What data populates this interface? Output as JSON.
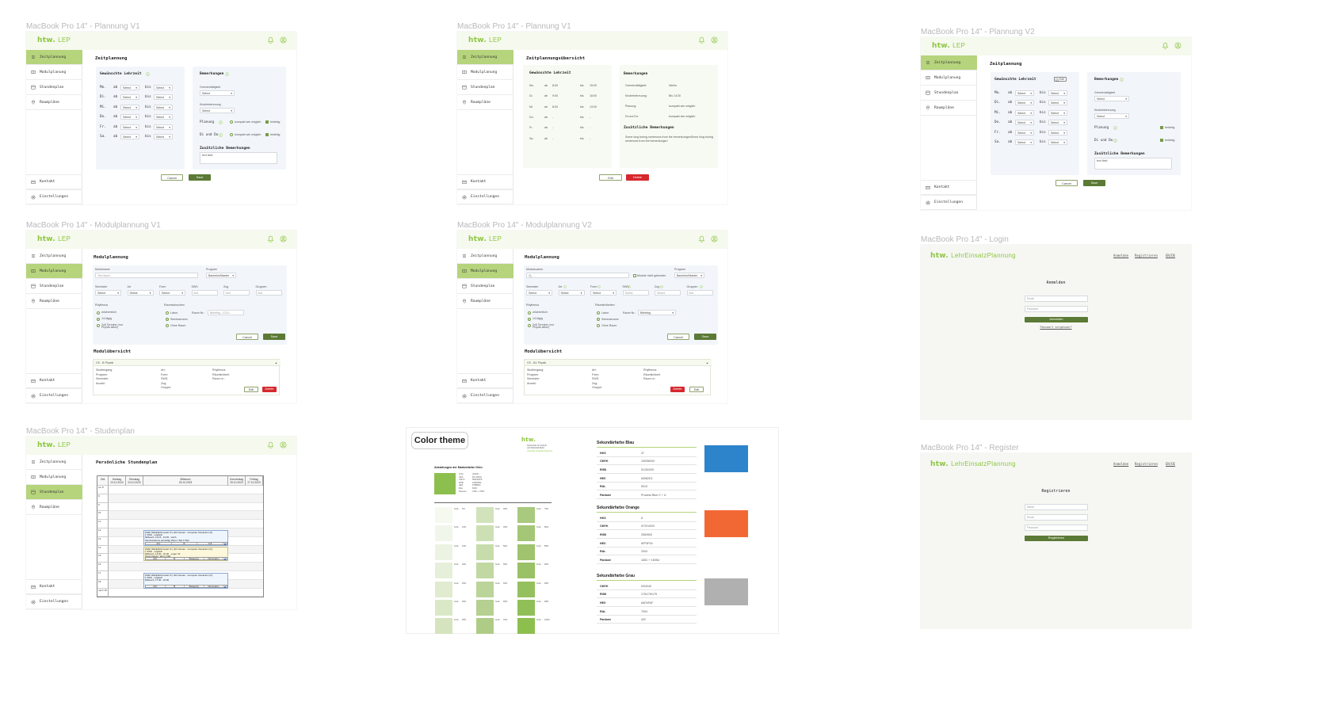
{
  "frames": {
    "plan_v1": {
      "label": "MacBook Pro 14\" - Plannung V1"
    },
    "plan_overview": {
      "label": "MacBook Pro 14\" - Plannung V1"
    },
    "plan_v2": {
      "label": "MacBook Pro 14\" - Plannung V2"
    },
    "modul_v1": {
      "label": "MacBook Pro 14\" - Modulplannung V1"
    },
    "modul_v2": {
      "label": "MacBook Pro 14\" - Modulplannung V2"
    },
    "login": {
      "label": "MacBook Pro 14\" - Login"
    },
    "stundenplan": {
      "label": "MacBook Pro 14\" - Studenplan"
    },
    "register": {
      "label": "MacBook Pro 14\" - Register"
    }
  },
  "brand": {
    "logo": "htw.",
    "app_short": "LEP",
    "app_long": "LehrEinsatzPlannung"
  },
  "nav": {
    "items": [
      "Zeitplannung",
      "Modulplanung",
      "Stundenplan",
      "Raumpläne"
    ],
    "icons": [
      "list-icon",
      "book-icon",
      "calendar-icon",
      "map-pin-icon"
    ],
    "bottom": [
      "Kontakt",
      "Einstellungen"
    ],
    "bottom_icons": [
      "mail-icon",
      "gear-icon"
    ]
  },
  "header_icons": [
    "bell-icon",
    "user-circle-icon"
  ],
  "colors": {
    "brand_green": "#8cc63f",
    "active_nav": "#b5d47c",
    "primary_button": "#5b7a35",
    "delete_button": "#d6282d",
    "panel_blue": "#f2f6fb",
    "header_green": "#f5f9ee"
  },
  "zeitplanung": {
    "title": "Zeitplannung",
    "lehrzeit": "Gewünschte Lehrzeit",
    "days": [
      "Mo.",
      "Di.",
      "Mi.",
      "Do.",
      "Fr.",
      "Sa."
    ],
    "ab": "ab",
    "bis": "bis",
    "select": "Select",
    "bemerkungen": "Bemerkungen",
    "gremien": "Gremientätigkeit",
    "kinder": "Kinderbetreuung",
    "planung": "Planung",
    "didu": "Di und Do",
    "kompakt": "kompakt wie möglich",
    "beliebig": "beliebig",
    "zusatz": "Zusätzliche Bemerkungen",
    "textfield": "text field",
    "cancel": "Cancel",
    "save": "Save",
    "edit": "Edit"
  },
  "overview": {
    "title": "Zeitplannungsübersicht",
    "rows": [
      {
        "day": "Mo.",
        "from": "8:00",
        "to": "15:00"
      },
      {
        "day": "Di.",
        "from": "9:00",
        "to": "18:00"
      },
      {
        "day": "Mi.",
        "from": "8:00",
        "to": "13:00"
      },
      {
        "day": "Do.",
        "from": "-",
        "to": "-"
      },
      {
        "day": "Fr.",
        "from": "-",
        "to": "-"
      },
      {
        "day": "Sa.",
        "from": "-",
        "to": "-"
      }
    ],
    "remarks": [
      {
        "label": "Gremientätigkeit:",
        "value": "Nichts"
      },
      {
        "label": "Kinderbetreuung:",
        "value": "Bis 14:30"
      },
      {
        "label": "Planung:",
        "value": "kompakt wie möglich"
      },
      {
        "label": "Di und Do:",
        "value": "kompakt wie möglich"
      }
    ],
    "zusatz_text": "Some long boring sentences from the bemerkungenSome long boring sentences from the bemerkungen",
    "edit": "Edit",
    "delete": "Delete"
  },
  "modul": {
    "title": "Modulplannung",
    "name_label": "Modulname",
    "name_placeholder": "Text input...",
    "search_label": "Modulsuchen",
    "search_placeholder": "...",
    "not_found": "Module nicht gefunden",
    "program_label": "Program",
    "program_value": "Bachelor/Master",
    "fields": [
      "Semester",
      "Art",
      "Form",
      "SWS",
      "Zug",
      "Gruppen"
    ],
    "select": "Select",
    "text": "text",
    "rhythmus": "Rhythmus",
    "rhythmus_options": [
      "wöchentlich",
      "14-tägig",
      "2x6 Termine (nur Physik-labor)"
    ],
    "raum_label": "Raumwünschen",
    "raum_label_v2": "Räumlichkeiten",
    "raum_options": [
      "Labor",
      "Seminarraum",
      "Ohne Raum"
    ],
    "raum_nr": "Raum Nr.:",
    "raum_nr_value": "Beliebig...C231...",
    "raum_nr_value_v2": "Beliebig",
    "cancel": "Cancel",
    "save": "Save",
    "overview_title": "Modulübersicht",
    "accordion_v1": "CE - B Physik",
    "accordion_v2": "CE - B1 Physik",
    "details": [
      [
        "Studiengang:",
        "Program:",
        "Semester:",
        "Anzahl:"
      ],
      [
        "Art:",
        "Form:",
        "SWS:",
        "Zug:",
        "Gruppe:"
      ],
      [
        "Rhythmus:",
        "Räumlichkeit:",
        "Raum nr.:"
      ]
    ],
    "edit": "Edit",
    "delete": "Delete"
  },
  "stundenplan": {
    "title": "Persönliche Stundenplan",
    "columns": [
      {
        "day": "Zeit",
        "date": ""
      },
      {
        "day": "Montag",
        "date": "23.10.2023"
      },
      {
        "day": "Dienstag",
        "date": "24.10.2023"
      },
      {
        "day": "Mittwoch",
        "date": "25.10.2023"
      },
      {
        "day": "Donnerstag",
        "date": "26.10.2023"
      },
      {
        "day": "Freitag",
        "date": "27.10.2023"
      }
    ],
    "hours": [
      "vor 8",
      "8",
      "9",
      "10",
      "11",
      "12",
      "13",
      "14",
      "15",
      "16",
      "17",
      "18",
      "nach 18"
    ],
    "events": [
      {
        "lines": [
          "WIAF Wahlpflichtmodul VI | HCI Human - Computer Interaction (S)",
          "1 SWS · englisch",
          "Mittwoch, 12:15 - 13:45 · wöch.",
          "Seminarräume (einzeilig) Raum: WH C 602"
        ],
        "buttons": [
          "2LV",
          "B",
          "6.8"
        ],
        "style": "blue"
      },
      {
        "lines": [
          "WIAF Wahlpflichtmodul VI | HCI Human - Computer Interaction (Ü)",
          "1 SWS · englisch",
          "Mittwoch, 14:00 - 15:30 · unger. W.",
          "Übung Raum: WH C 538"
        ],
        "buttons": [
          "2LV",
          "B",
          "Belegung abmelden",
          "Information"
        ],
        "style": "yellow"
      },
      {
        "lines": [
          "WIAF Wahlpflichtmodul VI | HCI Human - Computer Interaction (Ü)",
          "1 SWS · englisch",
          "Mittwoch, 17:30 - 19:00"
        ],
        "buttons": [
          "2LV",
          "B",
          "Belegung abmelden",
          "Information"
        ],
        "style": "blue"
      }
    ]
  },
  "login": {
    "links": [
      "Anmelden",
      "Registrieren",
      "EN/DE"
    ],
    "heading": "Anmelden",
    "email": "Email",
    "password": "Passwort",
    "submit": "Anmelden",
    "forgot": "Passwort vergessen?"
  },
  "register": {
    "heading": "Registrieren",
    "name": "Name",
    "email": "Email",
    "password": "Passwort",
    "submit": "Registrieren"
  },
  "color_theme": {
    "title": "Color theme",
    "logo_sub": [
      "Hochschule für Technik",
      "und Wirtschaft Berlin"
    ],
    "logo_tag": "University of Applied Sciences",
    "section": "Abstufungen der Markenfarbe Grün",
    "main": {
      "color": "#8dbf4f",
      "rows": [
        [
          "Grün",
          "(100%)"
        ],
        [
          "HKS",
          "66 (100%)"
        ],
        [
          "CMYK",
          "55/0/100/0"
        ],
        [
          "RGB",
          "118/185/0"
        ],
        [
          "HEX",
          "#76B900"
        ],
        [
          "RAL",
          "6018"
        ],
        [
          "Pantone",
          "376C + 375U"
        ]
      ]
    },
    "shades": [
      [
        "#f5f9f0",
        "#f1f6ea",
        "#ecf3e2",
        "#e6efd9",
        "#e0ebd0",
        "#dbe8c8",
        "#d5e4bf"
      ],
      [
        "#d2e3bc",
        "#cde0b4",
        "#c7dcab",
        "#c1d8a2",
        "#bbd499",
        "#b5d090",
        "#afcc87"
      ],
      [
        "#a9c97e",
        "#a4c676",
        "#9fc36e",
        "#9ac166",
        "#95c05e",
        "#91bf57",
        "#8dbf4f"
      ]
    ],
    "shade_labels": [
      [
        "5%",
        "10%",
        "15%",
        "20%",
        "25%",
        "30%",
        "35%"
      ],
      [
        "40%",
        "45%",
        "50%",
        "55%",
        "60%",
        "65%",
        "70%"
      ],
      [
        "75%",
        "80%",
        "85%",
        "90%",
        "95%",
        "98%",
        "100%"
      ]
    ],
    "shade_name": "Grün",
    "secondary": [
      {
        "title": "Sekundärfarbe Blau",
        "color": "#2d84cb",
        "rows": [
          [
            "HKS",
            "47"
          ],
          [
            "CMYK",
            "100/56/0/0"
          ],
          [
            "RGB",
            "0/130/209"
          ],
          [
            "HEX",
            "#0082D1"
          ],
          [
            "RAL",
            "5015"
          ],
          [
            "Pantone",
            "Process Blue C + U"
          ]
        ]
      },
      {
        "title": "Sekundärfarbe Orange",
        "color": "#f26835",
        "rows": [
          [
            "HKS",
            "8"
          ],
          [
            "CMYK",
            "0/70/100/0"
          ],
          [
            "RGB",
            "255/95/0"
          ],
          [
            "HEX",
            "#FF5F00"
          ],
          [
            "RAL",
            "2004"
          ],
          [
            "Pantone",
            "165C + 1505U"
          ]
        ]
      },
      {
        "title": "Sekundärfarbe Grau",
        "color": "#b0b0b0",
        "rows": [
          [
            "CMYK",
            "0/0/0/40"
          ],
          [
            "RGB",
            "175/175/175"
          ],
          [
            "HEX",
            "#AFAFAF"
          ],
          [
            "RAL",
            "7004"
          ],
          [
            "Pantone",
            "422"
          ]
        ]
      }
    ]
  }
}
